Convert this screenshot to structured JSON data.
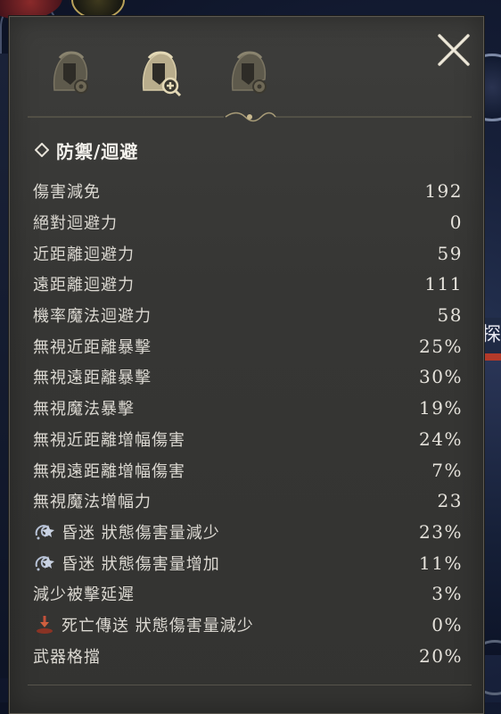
{
  "section": {
    "title": "防禦/迴避"
  },
  "tabs": [
    {
      "icon": "helmet-gear-icon"
    },
    {
      "icon": "helmet-zoom-icon"
    },
    {
      "icon": "helmet-gear-icon"
    }
  ],
  "stats": [
    {
      "label": "傷害減免",
      "value": "192"
    },
    {
      "label": "絕對迴避力",
      "value": "0"
    },
    {
      "label": "近距離迴避力",
      "value": "59"
    },
    {
      "label": "遠距離迴避力",
      "value": "111"
    },
    {
      "label": "機率魔法迴避力",
      "value": "58"
    },
    {
      "label": "無視近距離暴擊",
      "value": "25%"
    },
    {
      "label": "無視遠距離暴擊",
      "value": "30%"
    },
    {
      "label": "無視魔法暴擊",
      "value": "19%"
    },
    {
      "label": "無視近距離增幅傷害",
      "value": "24%"
    },
    {
      "label": "無視遠距離增幅傷害",
      "value": "7%"
    },
    {
      "label": "無視魔法增幅力",
      "value": "23"
    },
    {
      "label": "昏迷 狀態傷害量減少",
      "value": "23%",
      "icon": "stun-icon"
    },
    {
      "label": "昏迷 狀態傷害量增加",
      "value": "11%",
      "icon": "stun-icon"
    },
    {
      "label": "減少被擊延遲",
      "value": "3%"
    },
    {
      "label": "死亡傳送 狀態傷害量減少",
      "value": "0%",
      "icon": "death-teleport-icon"
    },
    {
      "label": "武器格擋",
      "value": "20%"
    }
  ],
  "background_text": "探",
  "colors": {
    "panel_bg": "#373735",
    "text": "#dcd9d2",
    "accent_gold": "#c9b98f",
    "stun_icon": "#b7c2d6",
    "death_icon": "#c4513a"
  }
}
